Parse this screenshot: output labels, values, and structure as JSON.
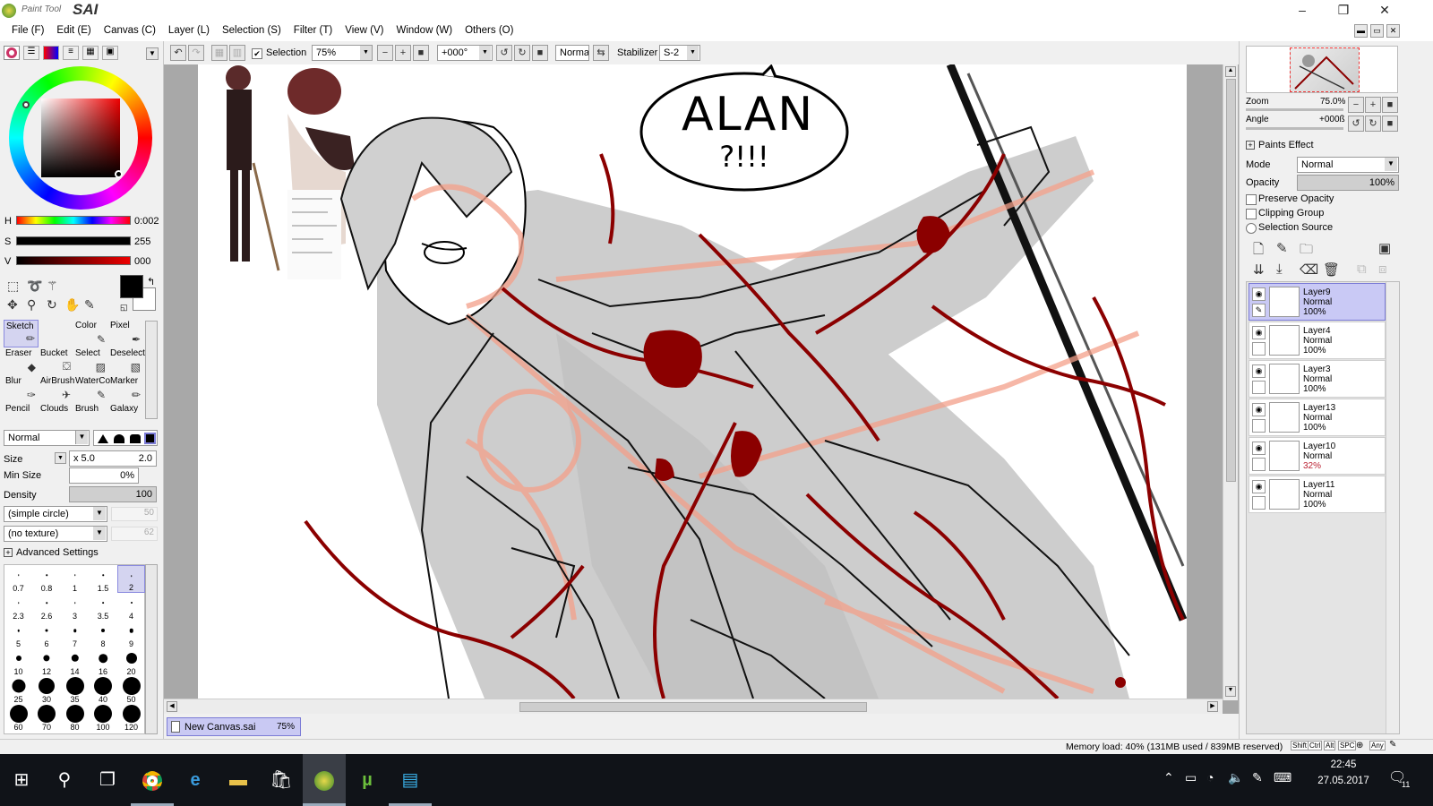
{
  "app": {
    "logo_small": "Paint Tool",
    "logo_big": "SAI"
  },
  "window_controls": {
    "minimize": "–",
    "restore": "❐",
    "close": "✕"
  },
  "menu": [
    "File (F)",
    "Edit (E)",
    "Canvas (C)",
    "Layer (L)",
    "Selection (S)",
    "Filter (T)",
    "View (V)",
    "Window (W)",
    "Others (O)"
  ],
  "toolbar": {
    "selection_label": "Selection",
    "zoom": "75%",
    "angle": "+000°",
    "blend": "Normal",
    "stabilizer_label": "Stabilizer",
    "stabilizer": "S-2"
  },
  "color": {
    "h_label": "H",
    "h_value": "0:002",
    "s_label": "S",
    "s_value": "255",
    "v_label": "V",
    "v_value": "000",
    "primary": "#000000",
    "secondary": "#ffffff"
  },
  "tools": [
    "Sketch",
    "Color",
    "Pixel",
    "Eraser",
    "Bucket",
    "Select",
    "Deselect",
    "Blur",
    "AirBrush",
    "WaterCo",
    "Marker",
    "Pencil",
    "Clouds",
    "Brush",
    "Galaxy"
  ],
  "brush": {
    "mode": "Normal",
    "size_label": "Size",
    "size_mult": "x 5.0",
    "size_value": "2.0",
    "minsize_label": "Min Size",
    "minsize_value": "0%",
    "density_label": "Density",
    "density_value": "100",
    "shape": "(simple circle)",
    "shape_val": "50",
    "texture": "(no texture)",
    "texture_val": "62",
    "advanced": "Advanced Settings",
    "sizes": [
      "0.7",
      "0.8",
      "1",
      "1.5",
      "2",
      "2.3",
      "2.6",
      "3",
      "3.5",
      "4",
      "5",
      "6",
      "7",
      "8",
      "9",
      "10",
      "12",
      "14",
      "16",
      "20",
      "25",
      "30",
      "35",
      "40",
      "50",
      "60",
      "70",
      "80",
      "100",
      "120"
    ]
  },
  "canvas": {
    "speech": "ALAN",
    "speech2": "?!!!",
    "tab_name": "New Canvas.sai",
    "tab_zoom": "75%"
  },
  "navigator": {
    "zoom_label": "Zoom",
    "zoom_value": "75.0%",
    "angle_label": "Angle",
    "angle_value": "+000ß"
  },
  "layer_props": {
    "paints_effect": "Paints Effect",
    "mode_label": "Mode",
    "mode_value": "Normal",
    "opacity_label": "Opacity",
    "opacity_value": "100%",
    "preserve_opacity": "Preserve Opacity",
    "clipping_group": "Clipping Group",
    "selection_source": "Selection Source"
  },
  "layers": [
    {
      "name": "Layer9",
      "mode": "Normal",
      "opacity": "100%"
    },
    {
      "name": "Layer4",
      "mode": "Normal",
      "opacity": "100%"
    },
    {
      "name": "Layer3",
      "mode": "Normal",
      "opacity": "100%"
    },
    {
      "name": "Layer13",
      "mode": "Normal",
      "opacity": "100%"
    },
    {
      "name": "Layer10",
      "mode": "Normal",
      "opacity": "32%"
    },
    {
      "name": "Layer11",
      "mode": "Normal",
      "opacity": "100%"
    }
  ],
  "status": {
    "memory": "Memory load: 40% (131MB used / 839MB reserved)",
    "keys": [
      "Shift",
      "Ctrl",
      "Alt",
      "SPC",
      "Any"
    ]
  },
  "taskbar": {
    "time": "22:45",
    "date": "27.05.2017",
    "notif": "11"
  }
}
